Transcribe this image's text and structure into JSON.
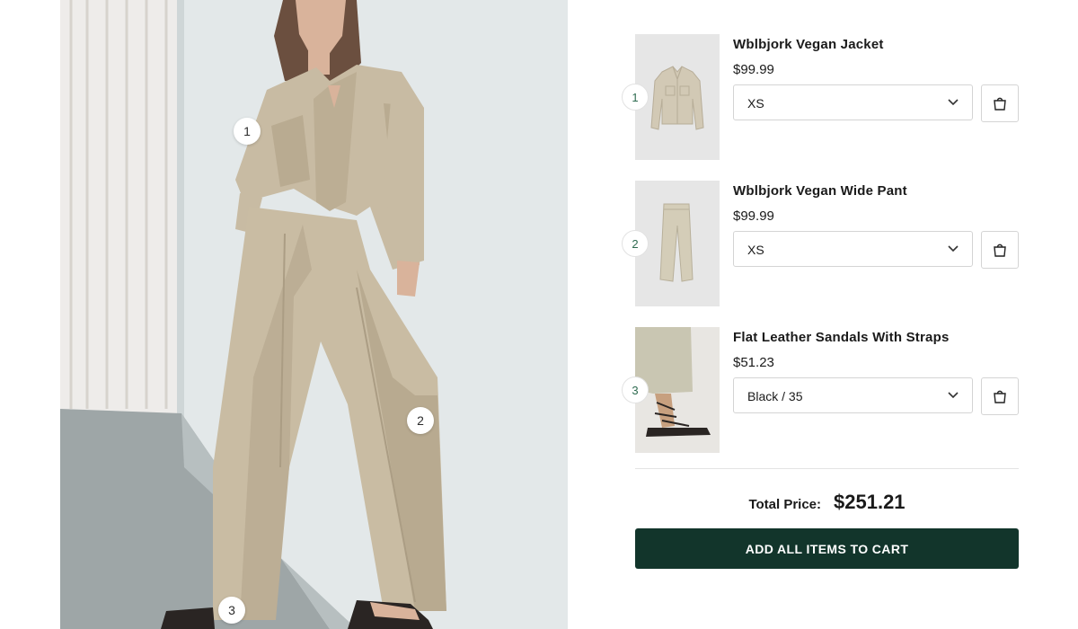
{
  "hotspots": [
    "1",
    "2",
    "3"
  ],
  "products": [
    {
      "number": "1",
      "name": "Wblbjork Vegan Jacket",
      "price": "$99.99",
      "option": "XS",
      "thumb_icon": "jacket-image"
    },
    {
      "number": "2",
      "name": "Wblbjork Vegan Wide Pant",
      "price": "$99.99",
      "option": "XS",
      "thumb_icon": "pants-image"
    },
    {
      "number": "3",
      "name": "Flat Leather Sandals With Straps",
      "price": "$51.23",
      "option": "Black / 35",
      "thumb_icon": "sandals-image"
    }
  ],
  "total": {
    "label": "Total Price:",
    "amount": "$251.21"
  },
  "cart_button": "ADD ALL ITEMS TO CART",
  "colors": {
    "accent": "#12352b",
    "hotspot_text": "#2e6b50",
    "garment": "#c2b49a"
  }
}
